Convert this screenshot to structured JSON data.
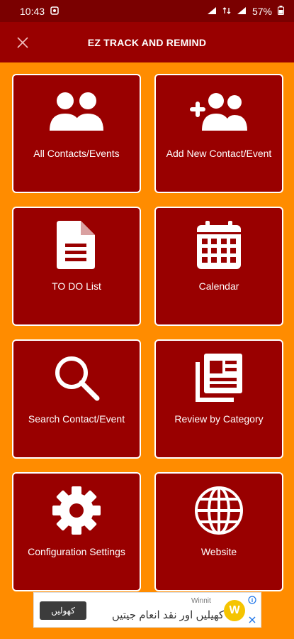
{
  "status_bar": {
    "time": "10:43",
    "battery": "57%",
    "colors": {
      "background": "#7a0000"
    }
  },
  "app_bar": {
    "title": "EZ TRACK AND REMIND",
    "close_icon": "close-icon",
    "colors": {
      "background": "#990000"
    }
  },
  "tiles": [
    {
      "label": "All Contacts/Events",
      "icon": "people-icon"
    },
    {
      "label": "Add New Contact/Event",
      "icon": "add-people-icon"
    },
    {
      "label": "TO DO List",
      "icon": "document-icon"
    },
    {
      "label": "Calendar",
      "icon": "calendar-icon"
    },
    {
      "label": "Search Contact/Event",
      "icon": "search-icon"
    },
    {
      "label": "Review by Category",
      "icon": "category-icon"
    },
    {
      "label": "Configuration Settings",
      "icon": "gear-icon"
    },
    {
      "label": "Website",
      "icon": "globe-icon"
    }
  ],
  "ad": {
    "button_label": "کھولیں",
    "brand": "Winnit",
    "text": "کھیلیں اور نقد انعام جیتیں",
    "logo_letter": "W"
  },
  "colors": {
    "page_background": "#ff8c00",
    "tile_background": "#990000",
    "tile_border": "#ffffff"
  }
}
